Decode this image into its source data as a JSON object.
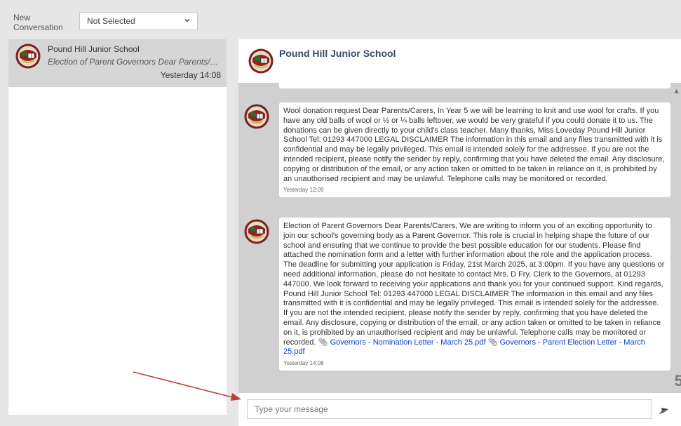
{
  "topbar": {
    "new_conversation_label": "New Conversation",
    "select_value": "Not Selected"
  },
  "conversations": [
    {
      "name": "Pound Hill Junior School",
      "preview": "Election of Parent Governors Dear Parents/Carers, We are writing to inform you of an exciting opportunity",
      "time": "Yesterday 14:08"
    }
  ],
  "chat": {
    "title": "Pound Hill Junior School",
    "messages": [
      {
        "text": "Wool donation request Dear Parents/Carers, In Year 5 we will be learning to knit and use wool for crafts. If you have any old balls of wool or ½ or ¼ balls leftover, we would be very grateful if you could donate it to us. The donations can be given directly to your child's class teacher. Many thanks, Miss Loveday Pound Hill Junior School Tel: 01293 447000 LEGAL DISCLAIMER The information in this email and any files transmitted with it is confidential and may be legally privileged. This email is intended solely for the addressee. If you are not the intended recipient, please notify the sender by reply, confirming that you have deleted the email. Any disclosure, copying or distribution of the email, or any action taken or omitted to be taken in reliance on it, is prohibited by an unauthorised recipient and may be unlawful. Telephone calls may be monitored or recorded.",
        "time": "Yesterday 12:09"
      },
      {
        "text": "Election of Parent Governors Dear Parents/Carers, We are writing to inform you of an exciting opportunity to join our school's governing body as a Parent Governor. This role is crucial in helping shape the future of our school and ensuring that we continue to provide the best possible education for our students. Please find attached the nomination form and a letter with further information about the role and the application process. The deadline for submitting your application is Friday, 21st March 2025, at 3:00pm. If you have any questions or need additional information, please do not hesitate to contact Mrs. D Fry, Clerk to the Governors, at 01293 447000. We look forward to receiving your applications and thank you for your continued support. Kind regards, Pound Hill Junior School Tel: 01293 447000 LEGAL DISCLAIMER The information in this email and any files transmitted with it is confidential and may be legally privileged. This email is intended solely for the addressee. If you are not the intended recipient, please notify the sender by reply, confirming that you have deleted the email. Any disclosure, copying or distribution of the email, or any action taken or omitted to be taken in reliance on it, is prohibited by an unauthorised recipient and may be unlawful. Telephone calls may be monitored or recorded.",
        "attachments": [
          "Governors - Nomination Letter - March 25.pdf",
          "Governors - Parent Election Letter - March 25.pdf"
        ],
        "time": "Yesterday 14:08"
      }
    ]
  },
  "input": {
    "placeholder": "Type your message"
  },
  "colors": {
    "header_title": "#37486b",
    "attachment_link": "#0b3fc8",
    "annotation_arrow": "#b9413b"
  },
  "icons": {
    "avatar": "school-crest-icon",
    "send": "send-icon",
    "attachment": "paperclip-icon",
    "select_caret": "chevron-down-icon"
  }
}
